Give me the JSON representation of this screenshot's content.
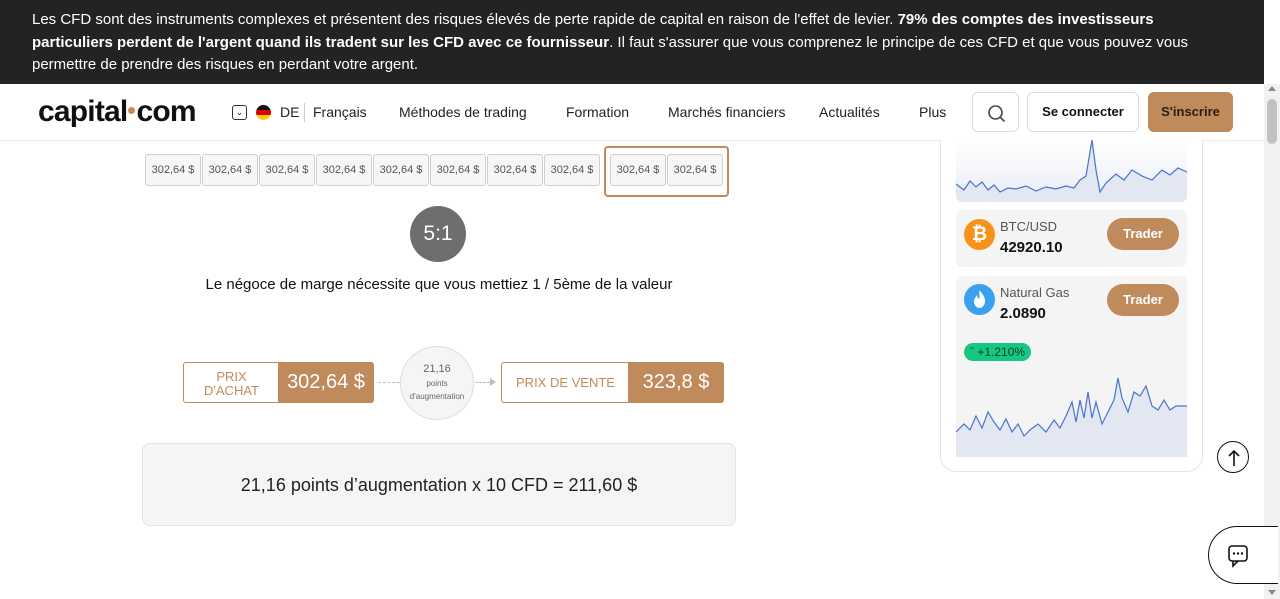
{
  "risk_banner": {
    "text_part1": "Les CFD sont des instruments complexes et présentent des risques élevés de perte rapide de capital en raison de l'effet de levier.",
    "text_bold": "79% des comptes des investisseurs particuliers perdent de l'argent quand ils tradent sur les CFD avec ce fournisseur",
    "text_part2": ". Il faut s'assurer que vous comprenez le principe de ces CFD et que vous pouvez vous permettre de prendre des risques en perdant votre argent."
  },
  "header": {
    "logo_part1": "capital",
    "logo_part2": "com",
    "lang_code": "DE",
    "lang_name": "Français",
    "nav": [
      "Méthodes de trading",
      "Formation",
      "Marchés financiers",
      "Actualités",
      "Plus"
    ],
    "login_label": "Se connecter",
    "signup_label": "S'inscrire"
  },
  "illustration": {
    "price_boxes": [
      "302,64 $",
      "302,64 $",
      "302,64 $",
      "302,64 $",
      "302,64 $",
      "302,64 $",
      "302,64 $",
      "302,64 $",
      "302,64 $",
      "302,64 $"
    ],
    "ratio": "5:1",
    "margin_text": "Le négoce de marge nécessite que vous mettiez 1 / 5ème de la valeur",
    "buy_label_line1": "PRIX",
    "buy_label_line2": "D'ACHAT",
    "buy_value": "302,64 $",
    "increase_value": "21,16",
    "increase_line1": "points",
    "increase_line2": "d'augmentation",
    "sell_label": "PRIX DE VENTE",
    "sell_value": "323,8 $",
    "result": "21,16 points d’augmentation x 10 CFD = 211,60 $"
  },
  "markets": {
    "items": [
      {
        "name": "BTC/USD",
        "price": "42920.10",
        "trade_label": "Trader",
        "icon": "bitcoin-icon",
        "color": "#f7931a"
      },
      {
        "name": "Natural Gas",
        "price": "2.0890",
        "trade_label": "Trader",
        "icon": "flame-icon",
        "color": "#3aa0f0",
        "change": "+1.210%"
      }
    ]
  },
  "colors": {
    "accent": "#c08b5c",
    "banner_bg": "#232323",
    "positive": "#16c784"
  }
}
